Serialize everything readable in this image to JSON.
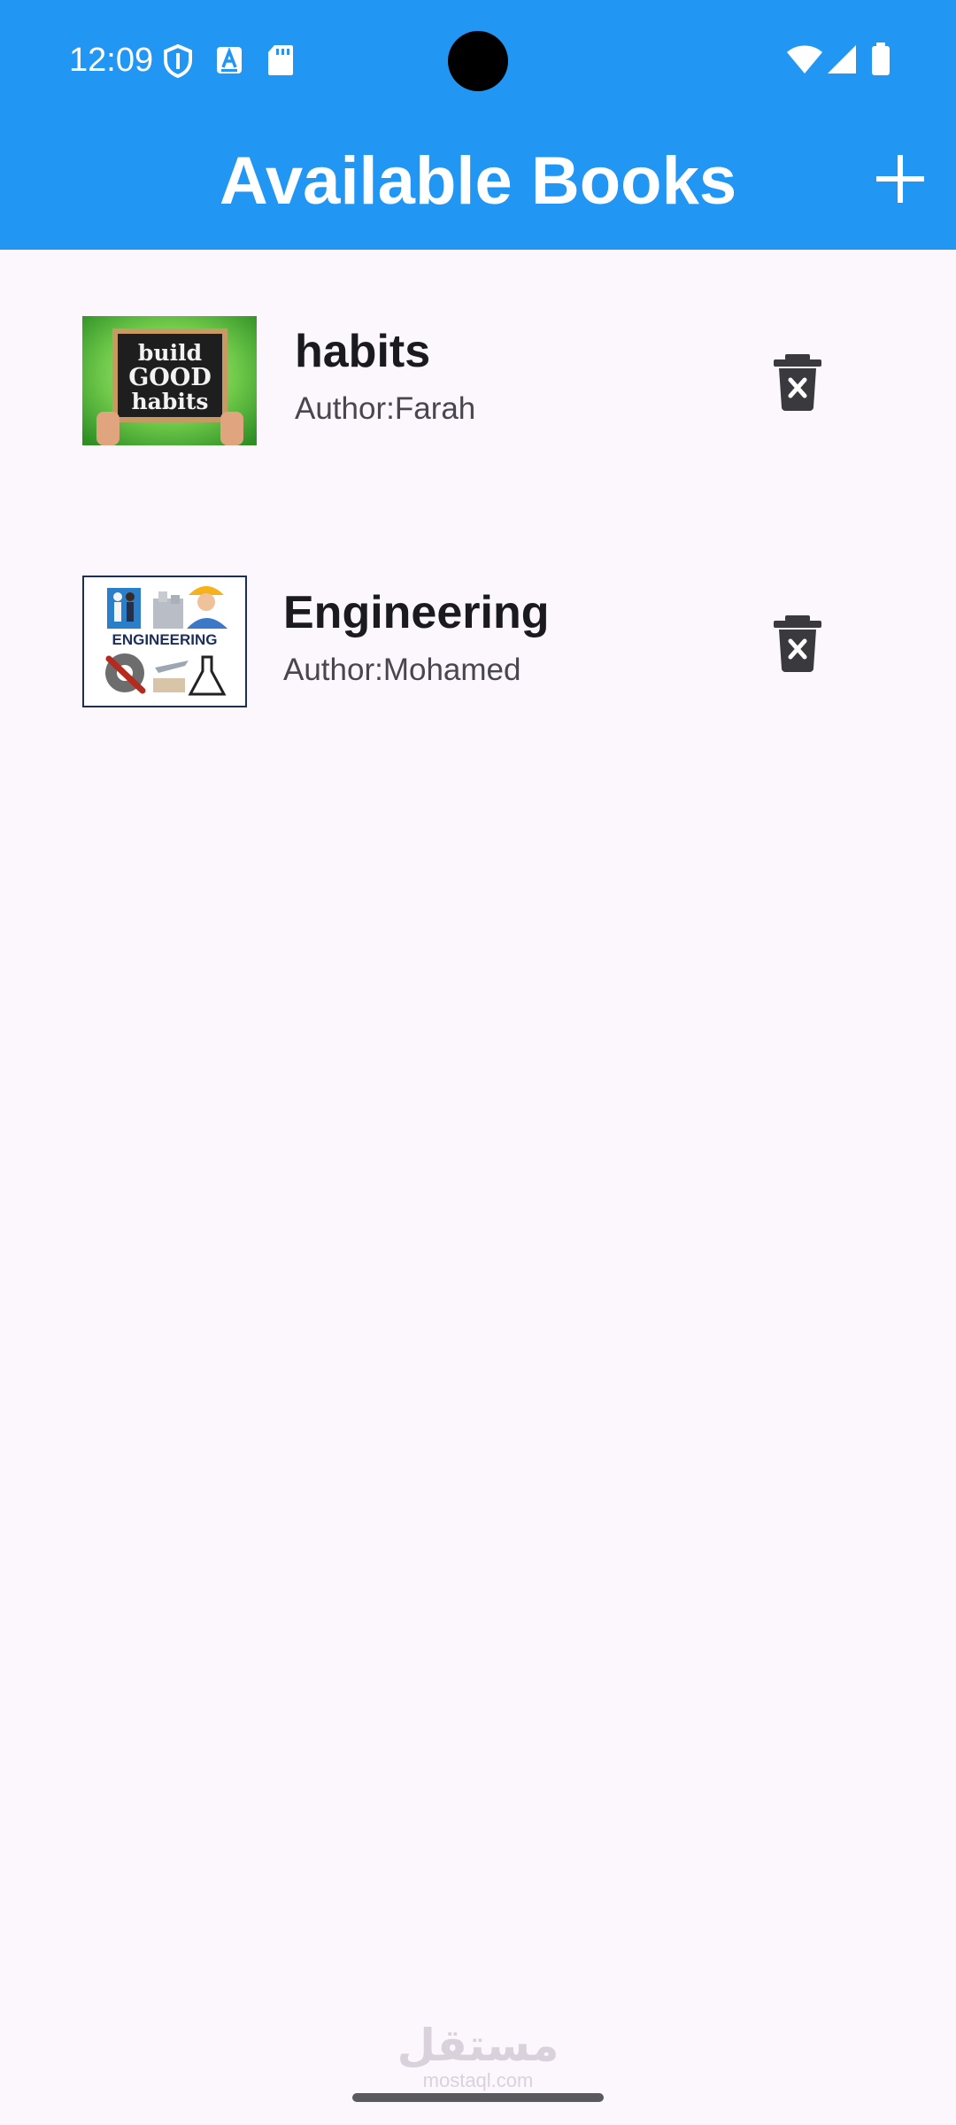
{
  "status_bar": {
    "time": "12:09",
    "left_icons": [
      "shield-icon",
      "text-a-icon",
      "sd-card-icon"
    ],
    "right_icons": [
      "wifi-icon",
      "cell-signal-icon",
      "battery-icon"
    ]
  },
  "app_bar": {
    "title": "Available Books",
    "action_icon": "add-icon",
    "color": "#2196F3"
  },
  "books": [
    {
      "title": "habits",
      "author": "Author:Farah",
      "cover_text": [
        "build",
        "GOOD",
        "habits"
      ],
      "action_icon": "delete-icon"
    },
    {
      "title": "Engineering",
      "author": "Author:Mohamed",
      "cover_text": [
        "ENGINEERING"
      ],
      "action_icon": "delete-icon"
    }
  ],
  "watermark": {
    "arabic": "مستقل",
    "latin": "mostaql.com"
  },
  "colors": {
    "background": "#FCF6FD",
    "title_text": "#1b1b1f",
    "subtitle_text": "#4a4650",
    "icon": "#3a3a3e"
  }
}
